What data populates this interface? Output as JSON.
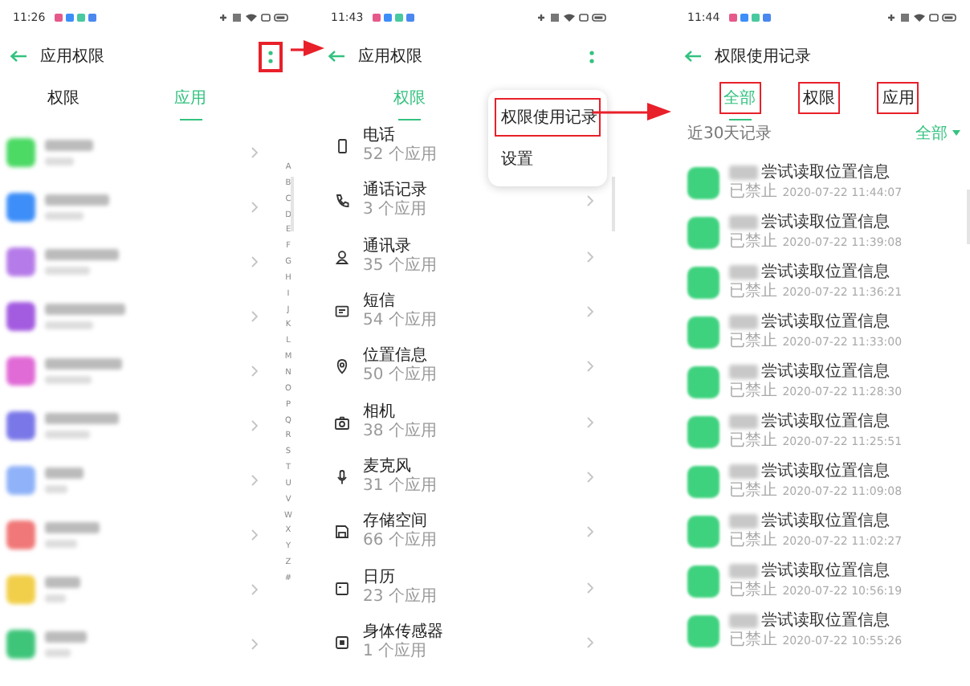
{
  "panels": [
    {
      "kind": "apps",
      "status_bar": {
        "time": "11:26"
      },
      "header": {
        "title": "应用权限",
        "menu_highlighted": true
      },
      "tabs": [
        {
          "label": "权限",
          "selected": false,
          "highlighted": false
        },
        {
          "label": "应用",
          "selected": true,
          "highlighted": false
        }
      ],
      "apps": [
        {
          "color": "#4cd964"
        },
        {
          "color": "#3d8ef8"
        },
        {
          "color": "#b57be8"
        },
        {
          "color": "#a35be0"
        },
        {
          "color": "#e06ad6"
        },
        {
          "color": "#7a78e8"
        },
        {
          "color": "#8fb2f8"
        },
        {
          "color": "#f07878"
        },
        {
          "color": "#f2cf4a"
        },
        {
          "color": "#3ec57a"
        }
      ],
      "index_letters": [
        "A",
        "B",
        "C",
        "D",
        "E",
        "F",
        "G",
        "H",
        "I",
        "J",
        "K",
        "L",
        "M",
        "N",
        "O",
        "P",
        "Q",
        "R",
        "S",
        "T",
        "U",
        "V",
        "W",
        "X",
        "Y",
        "Z",
        "#"
      ]
    },
    {
      "kind": "permissions",
      "status_bar": {
        "time": "11:43"
      },
      "header": {
        "title": "应用权限",
        "menu_highlighted": false
      },
      "tabs": [
        {
          "label": "权限",
          "selected": true,
          "highlighted": false
        }
      ],
      "permissions": [
        {
          "name": "电话",
          "count": "52 个应用"
        },
        {
          "name": "通话记录",
          "count": "3 个应用"
        },
        {
          "name": "通讯录",
          "count": "35 个应用"
        },
        {
          "name": "短信",
          "count": "54 个应用"
        },
        {
          "name": "位置信息",
          "count": "50 个应用"
        },
        {
          "name": "相机",
          "count": "38 个应用"
        },
        {
          "name": "麦克风",
          "count": "31 个应用"
        },
        {
          "name": "存储空间",
          "count": "66 个应用"
        },
        {
          "name": "日历",
          "count": "23 个应用"
        },
        {
          "name": "身体传感器",
          "count": "1 个应用"
        }
      ],
      "menu": [
        {
          "label": "权限使用记录",
          "highlighted": true
        },
        {
          "label": "设置",
          "highlighted": false
        }
      ]
    },
    {
      "kind": "records",
      "status_bar": {
        "time": "11:44"
      },
      "header": {
        "title": "权限使用记录"
      },
      "tabs": [
        {
          "label": "全部",
          "selected": true,
          "highlighted": true
        },
        {
          "label": "权限",
          "selected": false,
          "highlighted": true
        },
        {
          "label": "应用",
          "selected": false,
          "highlighted": true
        }
      ],
      "range_label": "近30天记录",
      "filter": "全部",
      "records": [
        {
          "action": "尝试读取位置信息",
          "status": "已禁止",
          "time": "2020-07-22 11:44:07"
        },
        {
          "action": "尝试读取位置信息",
          "status": "已禁止",
          "time": "2020-07-22 11:39:08"
        },
        {
          "action": "尝试读取位置信息",
          "status": "已禁止",
          "time": "2020-07-22 11:36:21"
        },
        {
          "action": "尝试读取位置信息",
          "status": "已禁止",
          "time": "2020-07-22 11:33:00"
        },
        {
          "action": "尝试读取位置信息",
          "status": "已禁止",
          "time": "2020-07-22 11:28:30"
        },
        {
          "action": "尝试读取位置信息",
          "status": "已禁止",
          "time": "2020-07-22 11:25:51"
        },
        {
          "action": "尝试读取位置信息",
          "status": "已禁止",
          "time": "2020-07-22 11:09:08"
        },
        {
          "action": "尝试读取位置信息",
          "status": "已禁止",
          "time": "2020-07-22 11:02:27"
        },
        {
          "action": "尝试读取位置信息",
          "status": "已禁止",
          "time": "2020-07-22 10:56:19"
        },
        {
          "action": "尝试读取位置信息",
          "status": "已禁止",
          "time": "2020-07-22 10:55:26"
        }
      ]
    }
  ]
}
